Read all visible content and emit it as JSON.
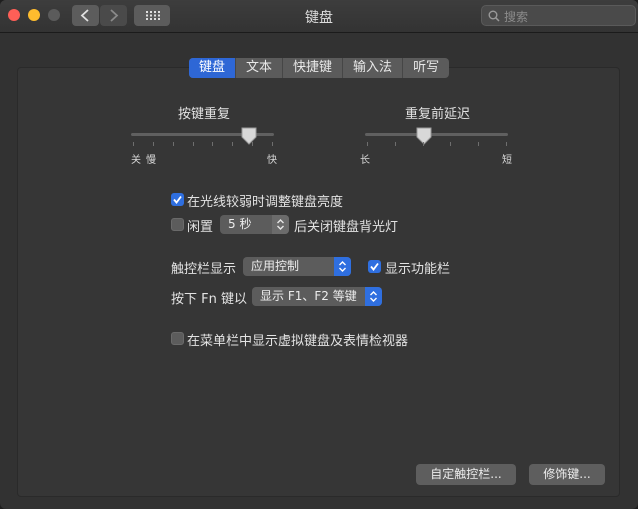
{
  "window": {
    "title": "键盘"
  },
  "search": {
    "placeholder": "搜索"
  },
  "tabs": [
    {
      "label": "键盘",
      "active": true
    },
    {
      "label": "文本",
      "active": false
    },
    {
      "label": "快捷键",
      "active": false
    },
    {
      "label": "输入法",
      "active": false
    },
    {
      "label": "听写",
      "active": false
    }
  ],
  "key_repeat": {
    "label": "按键重复",
    "left_label": "关",
    "left_label2": "慢",
    "right_label": "快",
    "value_fraction": 0.8
  },
  "delay_until_repeat": {
    "label": "重复前延迟",
    "left_label": "长",
    "right_label": "短",
    "value_fraction": 0.4
  },
  "options": {
    "adjust_brightness": {
      "label": "在光线较弱时调整键盘亮度",
      "checked": true
    },
    "idle_backlight": {
      "label_before": "闲置",
      "value": "5 秒",
      "label_after": "后关闭键盘背光灯",
      "checked": false
    },
    "touch_bar": {
      "label": "触控栏显示",
      "value": "应用控制"
    },
    "show_function_row": {
      "label": "显示功能栏",
      "checked": true
    },
    "fn_key": {
      "label": "按下 Fn 键以",
      "value": "显示 F1、F2 等键"
    },
    "show_viewers": {
      "label": "在菜单栏中显示虚拟键盘及表情检视器",
      "checked": false
    }
  },
  "buttons": {
    "customize_touch_bar": "自定触控栏...",
    "modifier_keys": "修饰键..."
  },
  "colors": {
    "accent": "#2f6fe0",
    "tab_active": "#2e67d6",
    "window_bg": "#323232"
  }
}
